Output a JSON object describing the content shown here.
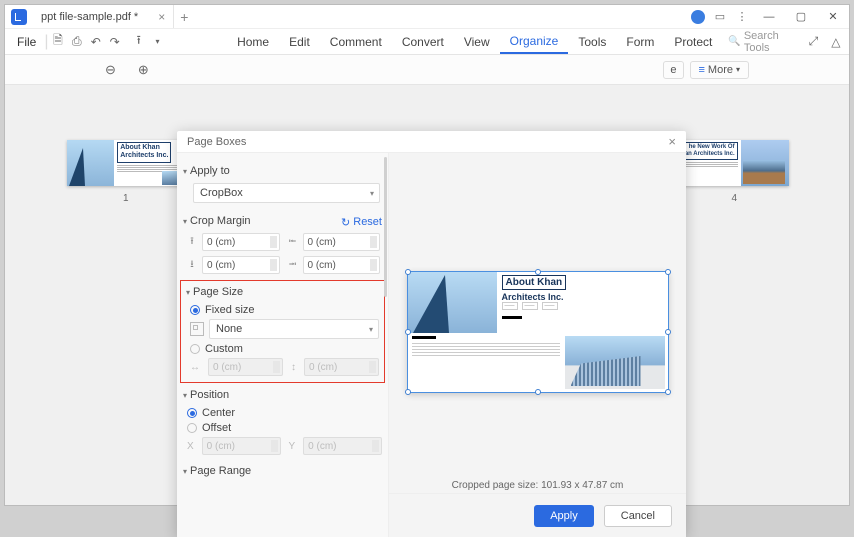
{
  "titlebar": {
    "filename": "ppt file-sample.pdf *"
  },
  "menubar": {
    "file": "File",
    "items": [
      "Home",
      "Edit",
      "Comment",
      "Convert",
      "View",
      "Organize",
      "Tools",
      "Form",
      "Protect"
    ],
    "active_index": 5,
    "search_placeholder": "Search Tools"
  },
  "toolbar": {
    "more": "More",
    "partial_btn": "e"
  },
  "thumbnails": {
    "page1": "1",
    "page4": "4",
    "doc_title": "About Khan\nArchitects Inc.",
    "doc_title_4": "he New Work Of\nan Architects Inc."
  },
  "dialog": {
    "title": "Page Boxes",
    "apply_to": {
      "label": "Apply to",
      "value": "CropBox"
    },
    "crop_margin": {
      "label": "Crop Margin",
      "reset": "Reset",
      "top": "0 (cm)",
      "bottom": "0 (cm)",
      "left": "0 (cm)",
      "right": "0 (cm)"
    },
    "page_size": {
      "label": "Page Size",
      "fixed": "Fixed size",
      "none": "None",
      "custom": "Custom",
      "w_placeholder": "0 (cm)",
      "h_placeholder": "0 (cm)"
    },
    "position": {
      "label": "Position",
      "center": "Center",
      "offset": "Offset",
      "x": "X",
      "x_val": "0 (cm)",
      "y": "Y",
      "y_val": "0 (cm)"
    },
    "page_range": {
      "label": "Page Range"
    },
    "preview": {
      "title1": "About Khan",
      "title2": "Architects Inc.",
      "cropped": "Cropped page size: 101.93 x 47.87 cm"
    },
    "buttons": {
      "apply": "Apply",
      "cancel": "Cancel"
    }
  }
}
